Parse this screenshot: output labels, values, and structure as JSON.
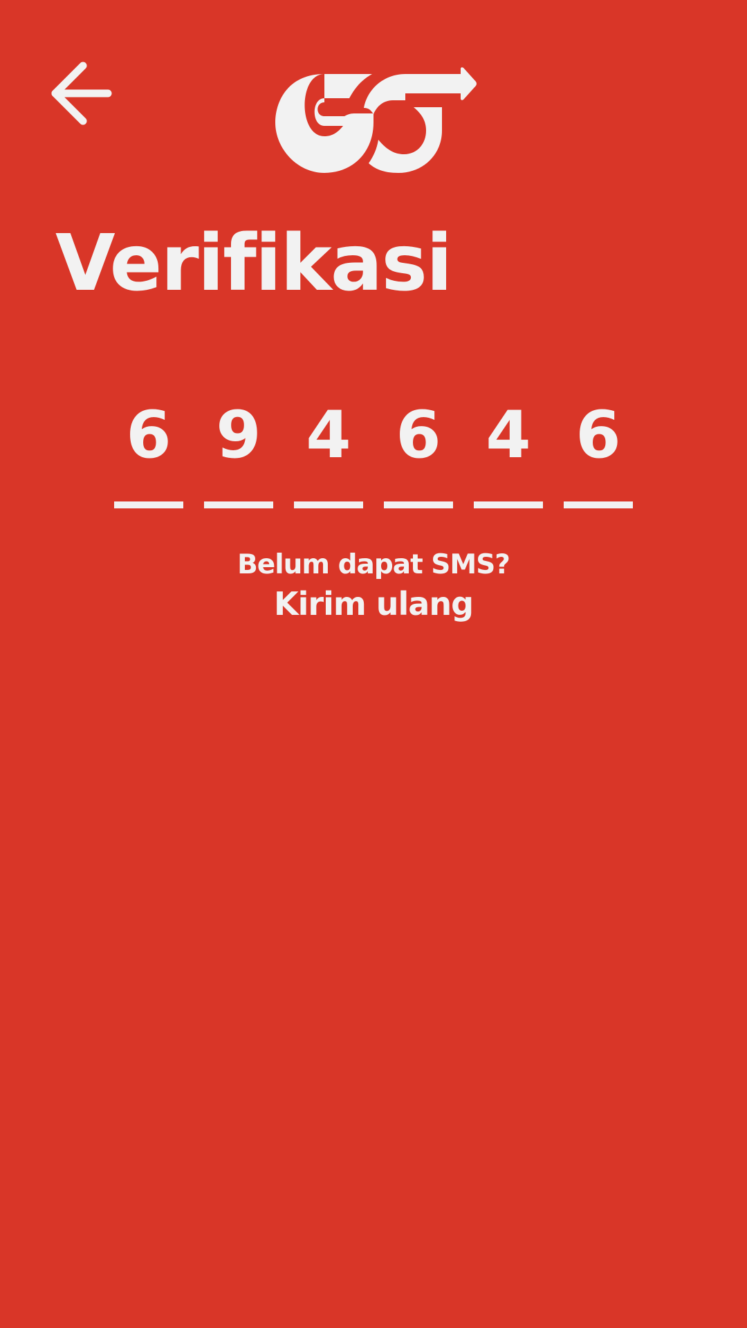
{
  "header": {
    "back_icon": "arrow-left-icon",
    "logo_icon": "go-logo-icon"
  },
  "page": {
    "title": "Verifikasi"
  },
  "otp": {
    "digits": [
      "6",
      "9",
      "4",
      "6",
      "4",
      "6"
    ]
  },
  "resend": {
    "question": "Belum dapat SMS?",
    "link_label": "Kirim ulang"
  },
  "colors": {
    "background": "#D93628",
    "foreground": "#F2F2F2"
  }
}
